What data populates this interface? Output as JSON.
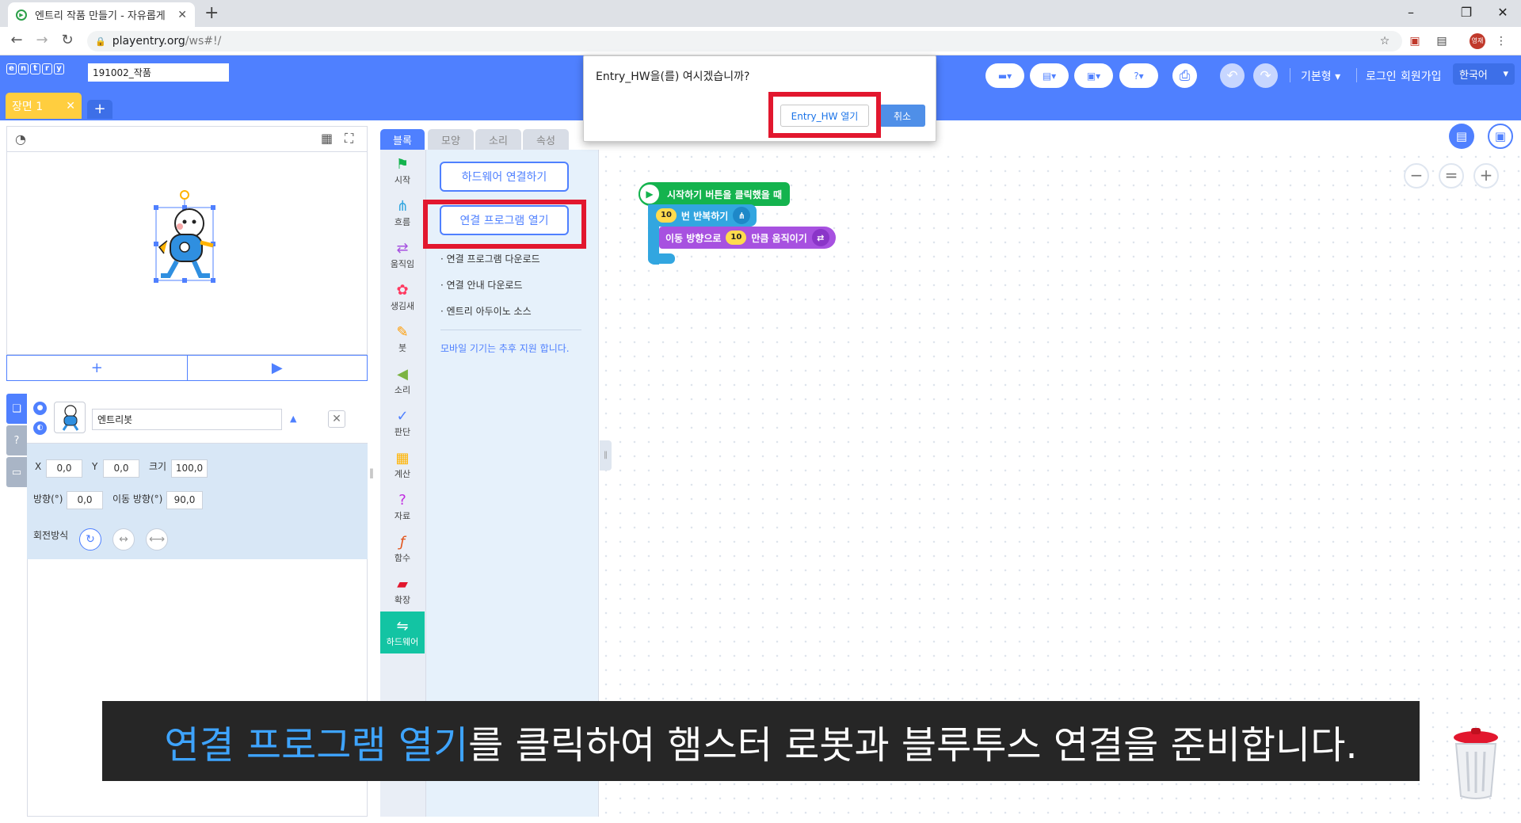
{
  "browser": {
    "tab_title": "엔트리 작품 만들기 - 자유롭게 ",
    "url_host": "playentry.org",
    "url_path": "/ws#!/",
    "profile_label": "영재"
  },
  "header": {
    "logo_letters": [
      "e",
      "n",
      "t",
      "r",
      "y"
    ],
    "project_name": "191002_작품",
    "mode_label": "기본형",
    "login_label": "로그인",
    "signup_label": "회원가입",
    "language": "한국어"
  },
  "scene": {
    "tab_label": "장면 1"
  },
  "object": {
    "name": "엔트리봇",
    "x_label": "X",
    "x_value": "0,0",
    "y_label": "Y",
    "y_value": "0,0",
    "size_label": "크기",
    "size_value": "100,0",
    "direction_label": "방향(°)",
    "direction_value": "0,0",
    "move_direction_label": "이동 방향(°)",
    "move_direction_value": "90,0",
    "rotation_label": "회전방식"
  },
  "workspace_tabs": [
    "블록",
    "모양",
    "소리",
    "속성"
  ],
  "categories": [
    {
      "label": "시작",
      "icon": "flag-icon",
      "color": "#14b34e"
    },
    {
      "label": "흐름",
      "icon": "flow-icon",
      "color": "#32a6e0"
    },
    {
      "label": "움직임",
      "icon": "move-icon",
      "color": "#a751e0"
    },
    {
      "label": "생김새",
      "icon": "looks-icon",
      "color": "#ff3a61"
    },
    {
      "label": "붓",
      "icon": "brush-icon",
      "color": "#ff9b00"
    },
    {
      "label": "소리",
      "icon": "sound-icon",
      "color": "#7cb342"
    },
    {
      "label": "판단",
      "icon": "check-icon",
      "color": "#4f80ff"
    },
    {
      "label": "계산",
      "icon": "calc-icon",
      "color": "#ffb300"
    },
    {
      "label": "자료",
      "icon": "data-icon",
      "color": "#c02be0"
    },
    {
      "label": "함수",
      "icon": "function-icon",
      "color": "#e2541b"
    },
    {
      "label": "확장",
      "icon": "extension-icon",
      "color": "#e2172e"
    },
    {
      "label": "하드웨어",
      "icon": "hardware-icon",
      "color": "#ffffff"
    }
  ],
  "palette": {
    "connect_hw_button": "하드웨어 연결하기",
    "open_program_button": "연결 프로그램 열기",
    "links": [
      "연결 프로그램 다운로드",
      "연결 안내 다운로드",
      "엔트리 아두이노 소스"
    ],
    "mobile_note": "모바일 기기는 추후 지원 합니다."
  },
  "blocks": {
    "start": "시작하기 버튼을 클릭했을 때",
    "repeat_count": "10",
    "repeat_text": "번 반복하기",
    "move_prefix": "이동 방향으로",
    "move_amount": "10",
    "move_suffix": "만큼 움직이기"
  },
  "dialog": {
    "message": "Entry_HW을(를) 여시겠습니까?",
    "open_button": "Entry_HW 열기",
    "cancel_button": "취소"
  },
  "caption": {
    "highlight": "연결 프로그램 열기",
    "rest": "를 클릭하여 햄스터 로봇과 블루투스 연결을 준비합니다."
  },
  "colors": {
    "brand_blue": "#4f80ff",
    "hardware_active": "#13c4a3",
    "highlight_red": "#e2172e",
    "caption_highlight": "#3ea4ff"
  }
}
